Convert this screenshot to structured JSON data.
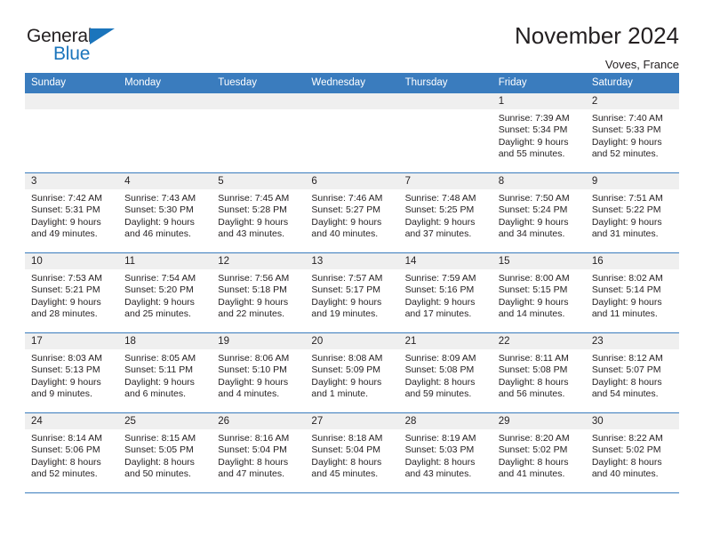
{
  "brand": {
    "line1": "General",
    "line2": "Blue",
    "triangle_color": "#1b75bc",
    "icon": "triangle-logo-icon"
  },
  "header": {
    "title": "November 2024",
    "location": "Voves, France",
    "accent_color": "#3A7CBE",
    "daynum_band_color": "#efefef"
  },
  "weekday_headers": [
    "Sunday",
    "Monday",
    "Tuesday",
    "Wednesday",
    "Thursday",
    "Friday",
    "Saturday"
  ],
  "weeks": [
    [
      {
        "day": "",
        "empty": true,
        "lines": []
      },
      {
        "day": "",
        "empty": true,
        "lines": []
      },
      {
        "day": "",
        "empty": true,
        "lines": []
      },
      {
        "day": "",
        "empty": true,
        "lines": []
      },
      {
        "day": "",
        "empty": true,
        "lines": []
      },
      {
        "day": "1",
        "empty": false,
        "lines": [
          "Sunrise: 7:39 AM",
          "Sunset: 5:34 PM",
          "Daylight: 9 hours",
          "and 55 minutes."
        ]
      },
      {
        "day": "2",
        "empty": false,
        "lines": [
          "Sunrise: 7:40 AM",
          "Sunset: 5:33 PM",
          "Daylight: 9 hours",
          "and 52 minutes."
        ]
      }
    ],
    [
      {
        "day": "3",
        "empty": false,
        "lines": [
          "Sunrise: 7:42 AM",
          "Sunset: 5:31 PM",
          "Daylight: 9 hours",
          "and 49 minutes."
        ]
      },
      {
        "day": "4",
        "empty": false,
        "lines": [
          "Sunrise: 7:43 AM",
          "Sunset: 5:30 PM",
          "Daylight: 9 hours",
          "and 46 minutes."
        ]
      },
      {
        "day": "5",
        "empty": false,
        "lines": [
          "Sunrise: 7:45 AM",
          "Sunset: 5:28 PM",
          "Daylight: 9 hours",
          "and 43 minutes."
        ]
      },
      {
        "day": "6",
        "empty": false,
        "lines": [
          "Sunrise: 7:46 AM",
          "Sunset: 5:27 PM",
          "Daylight: 9 hours",
          "and 40 minutes."
        ]
      },
      {
        "day": "7",
        "empty": false,
        "lines": [
          "Sunrise: 7:48 AM",
          "Sunset: 5:25 PM",
          "Daylight: 9 hours",
          "and 37 minutes."
        ]
      },
      {
        "day": "8",
        "empty": false,
        "lines": [
          "Sunrise: 7:50 AM",
          "Sunset: 5:24 PM",
          "Daylight: 9 hours",
          "and 34 minutes."
        ]
      },
      {
        "day": "9",
        "empty": false,
        "lines": [
          "Sunrise: 7:51 AM",
          "Sunset: 5:22 PM",
          "Daylight: 9 hours",
          "and 31 minutes."
        ]
      }
    ],
    [
      {
        "day": "10",
        "empty": false,
        "lines": [
          "Sunrise: 7:53 AM",
          "Sunset: 5:21 PM",
          "Daylight: 9 hours",
          "and 28 minutes."
        ]
      },
      {
        "day": "11",
        "empty": false,
        "lines": [
          "Sunrise: 7:54 AM",
          "Sunset: 5:20 PM",
          "Daylight: 9 hours",
          "and 25 minutes."
        ]
      },
      {
        "day": "12",
        "empty": false,
        "lines": [
          "Sunrise: 7:56 AM",
          "Sunset: 5:18 PM",
          "Daylight: 9 hours",
          "and 22 minutes."
        ]
      },
      {
        "day": "13",
        "empty": false,
        "lines": [
          "Sunrise: 7:57 AM",
          "Sunset: 5:17 PM",
          "Daylight: 9 hours",
          "and 19 minutes."
        ]
      },
      {
        "day": "14",
        "empty": false,
        "lines": [
          "Sunrise: 7:59 AM",
          "Sunset: 5:16 PM",
          "Daylight: 9 hours",
          "and 17 minutes."
        ]
      },
      {
        "day": "15",
        "empty": false,
        "lines": [
          "Sunrise: 8:00 AM",
          "Sunset: 5:15 PM",
          "Daylight: 9 hours",
          "and 14 minutes."
        ]
      },
      {
        "day": "16",
        "empty": false,
        "lines": [
          "Sunrise: 8:02 AM",
          "Sunset: 5:14 PM",
          "Daylight: 9 hours",
          "and 11 minutes."
        ]
      }
    ],
    [
      {
        "day": "17",
        "empty": false,
        "lines": [
          "Sunrise: 8:03 AM",
          "Sunset: 5:13 PM",
          "Daylight: 9 hours",
          "and 9 minutes."
        ]
      },
      {
        "day": "18",
        "empty": false,
        "lines": [
          "Sunrise: 8:05 AM",
          "Sunset: 5:11 PM",
          "Daylight: 9 hours",
          "and 6 minutes."
        ]
      },
      {
        "day": "19",
        "empty": false,
        "lines": [
          "Sunrise: 8:06 AM",
          "Sunset: 5:10 PM",
          "Daylight: 9 hours",
          "and 4 minutes."
        ]
      },
      {
        "day": "20",
        "empty": false,
        "lines": [
          "Sunrise: 8:08 AM",
          "Sunset: 5:09 PM",
          "Daylight: 9 hours",
          "and 1 minute."
        ]
      },
      {
        "day": "21",
        "empty": false,
        "lines": [
          "Sunrise: 8:09 AM",
          "Sunset: 5:08 PM",
          "Daylight: 8 hours",
          "and 59 minutes."
        ]
      },
      {
        "day": "22",
        "empty": false,
        "lines": [
          "Sunrise: 8:11 AM",
          "Sunset: 5:08 PM",
          "Daylight: 8 hours",
          "and 56 minutes."
        ]
      },
      {
        "day": "23",
        "empty": false,
        "lines": [
          "Sunrise: 8:12 AM",
          "Sunset: 5:07 PM",
          "Daylight: 8 hours",
          "and 54 minutes."
        ]
      }
    ],
    [
      {
        "day": "24",
        "empty": false,
        "lines": [
          "Sunrise: 8:14 AM",
          "Sunset: 5:06 PM",
          "Daylight: 8 hours",
          "and 52 minutes."
        ]
      },
      {
        "day": "25",
        "empty": false,
        "lines": [
          "Sunrise: 8:15 AM",
          "Sunset: 5:05 PM",
          "Daylight: 8 hours",
          "and 50 minutes."
        ]
      },
      {
        "day": "26",
        "empty": false,
        "lines": [
          "Sunrise: 8:16 AM",
          "Sunset: 5:04 PM",
          "Daylight: 8 hours",
          "and 47 minutes."
        ]
      },
      {
        "day": "27",
        "empty": false,
        "lines": [
          "Sunrise: 8:18 AM",
          "Sunset: 5:04 PM",
          "Daylight: 8 hours",
          "and 45 minutes."
        ]
      },
      {
        "day": "28",
        "empty": false,
        "lines": [
          "Sunrise: 8:19 AM",
          "Sunset: 5:03 PM",
          "Daylight: 8 hours",
          "and 43 minutes."
        ]
      },
      {
        "day": "29",
        "empty": false,
        "lines": [
          "Sunrise: 8:20 AM",
          "Sunset: 5:02 PM",
          "Daylight: 8 hours",
          "and 41 minutes."
        ]
      },
      {
        "day": "30",
        "empty": false,
        "lines": [
          "Sunrise: 8:22 AM",
          "Sunset: 5:02 PM",
          "Daylight: 8 hours",
          "and 40 minutes."
        ]
      }
    ]
  ]
}
